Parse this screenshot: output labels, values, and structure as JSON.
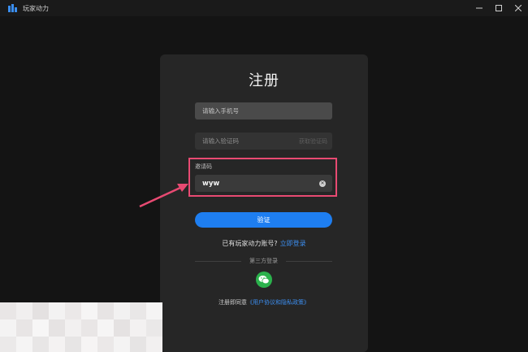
{
  "window": {
    "title": "玩家动力",
    "logo_icon": "app-logo-icon",
    "controls": [
      "minimize-icon",
      "maximize-icon",
      "close-icon"
    ]
  },
  "register": {
    "title": "注册",
    "phone_placeholder": "请输入手机号",
    "code_placeholder": "请输入验证码",
    "get_code_label": "获取验证码",
    "invite_label": "邀请码",
    "invite_value": "wyw",
    "submit_label": "验证",
    "has_account_text": "已有玩家动力账号?",
    "login_link": "立即登录",
    "third_party_label": "第三方登录",
    "agreement_prefix": "注册即同意",
    "agreement_link": "《用户协议和隐私政策》"
  },
  "colors": {
    "accent": "#1e7ef0",
    "highlight": "#e84a72",
    "wechat": "#2bb24c"
  }
}
